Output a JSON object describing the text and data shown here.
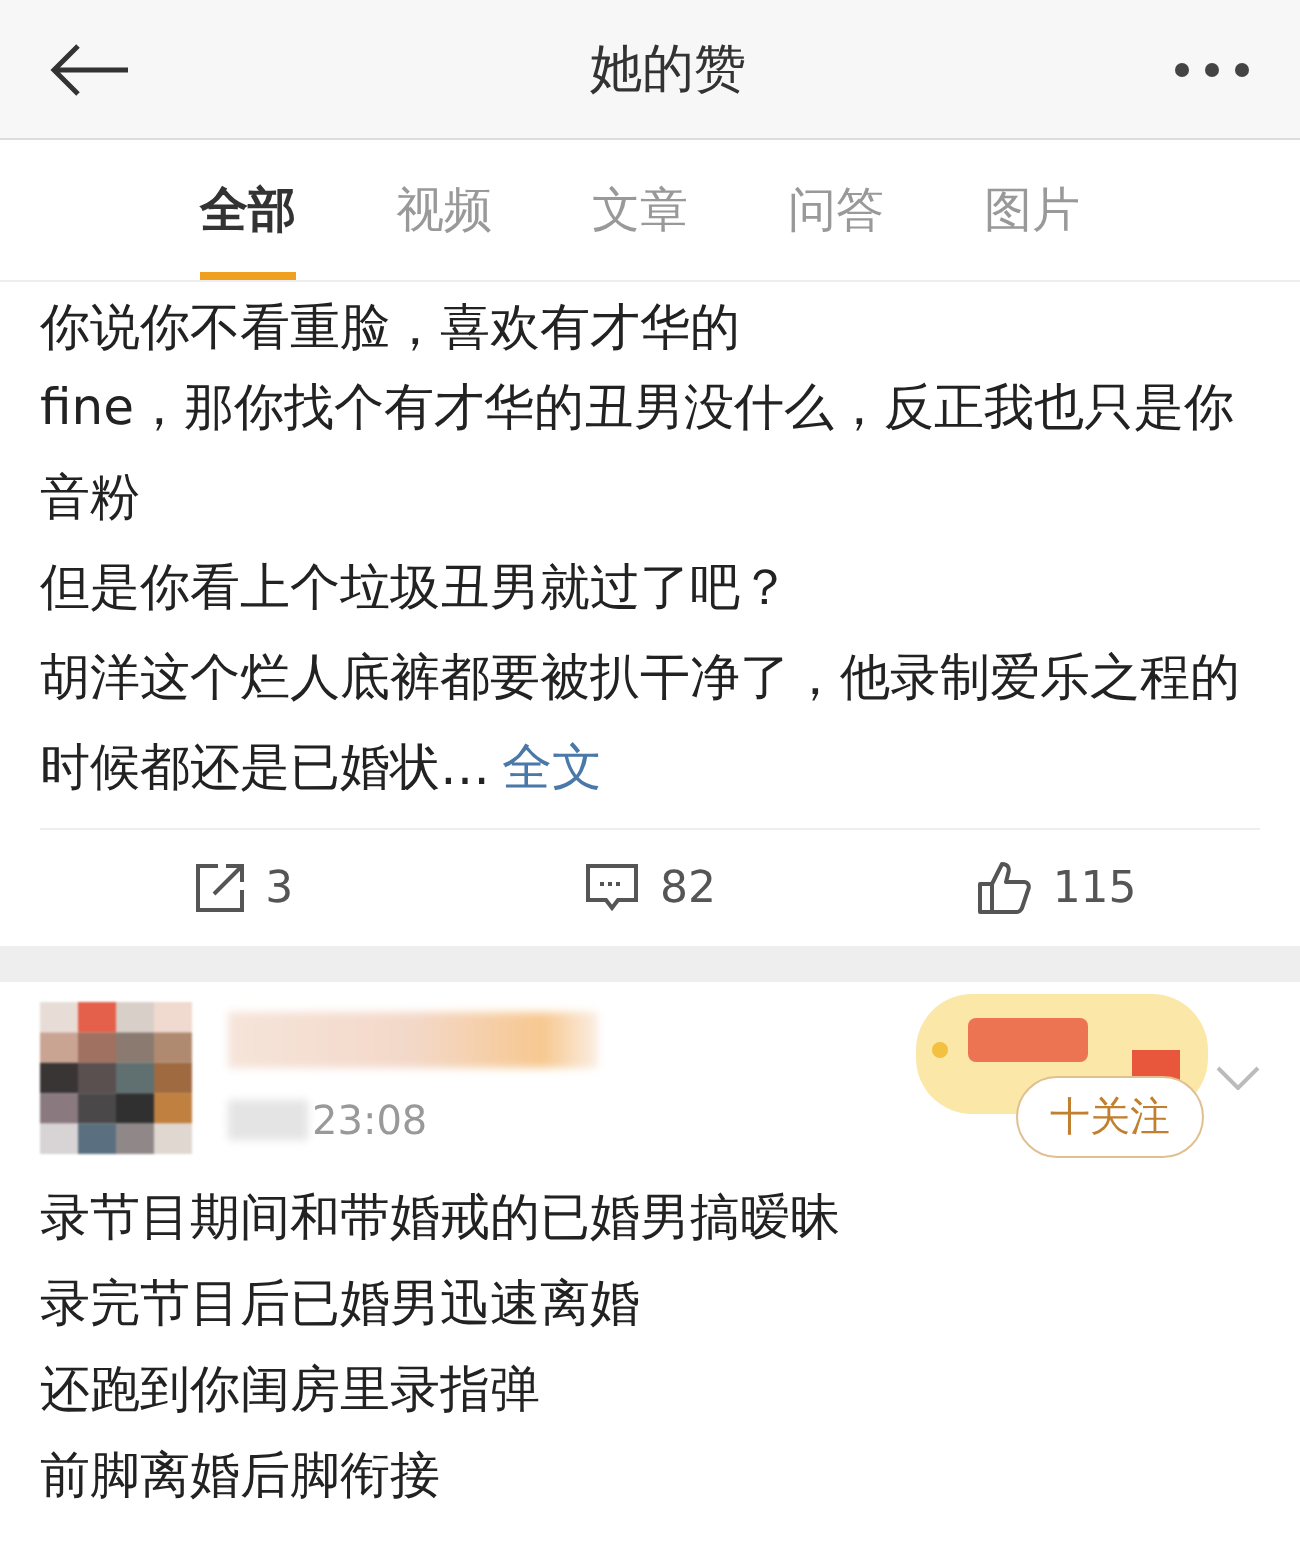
{
  "header": {
    "title": "她的赞"
  },
  "tabs": [
    {
      "label": "全部",
      "selected": true
    },
    {
      "label": "视频",
      "selected": false
    },
    {
      "label": "文章",
      "selected": false
    },
    {
      "label": "问答",
      "selected": false
    },
    {
      "label": "图片",
      "selected": false
    }
  ],
  "post": {
    "lines": [
      "你说你不看重脸，喜欢有才华的",
      "fine，那你找个有才华的丑男没什么，反正我也只是你音粉",
      "但是你看上个垃圾丑男就过了吧？",
      "胡洋这个烂人底裤都要被扒干净了，他录制爱乐之程的时候都还是已婚状…"
    ],
    "more_link": "全文",
    "actions": [
      {
        "kind": "share",
        "count": "3"
      },
      {
        "kind": "comment",
        "count": "82"
      },
      {
        "kind": "like",
        "count": "115"
      }
    ]
  },
  "post2": {
    "time": "23:08",
    "follow_button": "十关注",
    "lines": [
      "录节目期间和带婚戒的已婚男搞暧昧",
      "录完节目后已婚男迅速离婚",
      "还跑到你闺房里录指弹",
      "前脚离婚后脚衔接"
    ]
  }
}
